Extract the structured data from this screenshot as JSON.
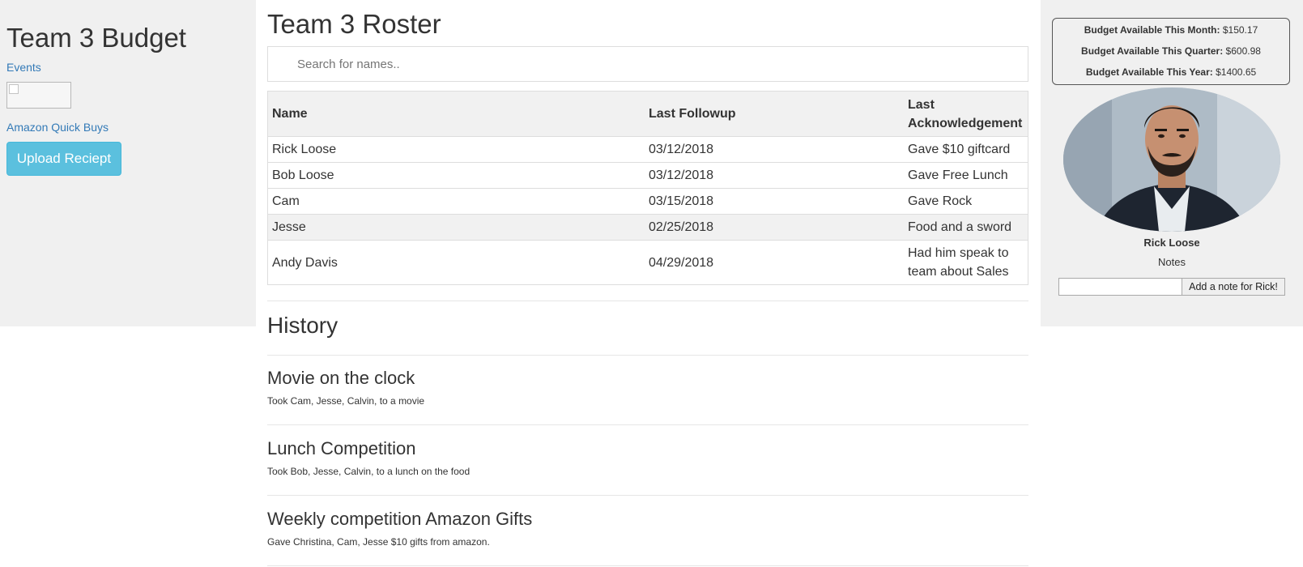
{
  "sidebar": {
    "title": "Team 3 Budget",
    "events_link": "Events",
    "image_name": "broken-image-icon",
    "amazon_link": "Amazon Quick Buys",
    "upload_button": "Upload Reciept",
    "upload_button_color": "#5bc0de"
  },
  "roster": {
    "title": "Team 3 Roster",
    "search_placeholder": "Search for names..",
    "columns": [
      "Name",
      "Last Followup",
      "Last Acknowledgement"
    ],
    "rows": [
      {
        "name": "Rick Loose",
        "followup": "03/12/2018",
        "ack": "Gave $10 giftcard"
      },
      {
        "name": "Bob Loose",
        "followup": "03/12/2018",
        "ack": "Gave Free Lunch"
      },
      {
        "name": "Cam",
        "followup": "03/15/2018",
        "ack": "Gave Rock"
      },
      {
        "name": "Jesse",
        "followup": "02/25/2018",
        "ack": "Food and a sword"
      },
      {
        "name": "Andy Davis",
        "followup": "04/29/2018",
        "ack": "Had him speak to team about Sales"
      }
    ]
  },
  "history": {
    "title": "History",
    "items": [
      {
        "title": "Movie on the clock",
        "desc": "Took Cam, Jesse, Calvin, to a movie"
      },
      {
        "title": "Lunch Competition",
        "desc": "Took Bob, Jesse, Calvin, to a lunch on the food"
      },
      {
        "title": "Weekly competition Amazon Gifts",
        "desc": "Gave Christina, Cam, Jesse $10 gifts from amazon."
      }
    ]
  },
  "budget": {
    "month_label": "Budget Available This Month:",
    "month_value": "$150.17",
    "quarter_label": "Budget Available This Quarter:",
    "quarter_value": "$600.98",
    "year_label": "Budget Available This Year:",
    "year_value": "$1400.65"
  },
  "profile": {
    "name": "Rick Loose",
    "notes_label": "Notes",
    "note_input_value": "",
    "add_note_button": "Add a note for Rick!",
    "photo": "portrait-photo"
  }
}
